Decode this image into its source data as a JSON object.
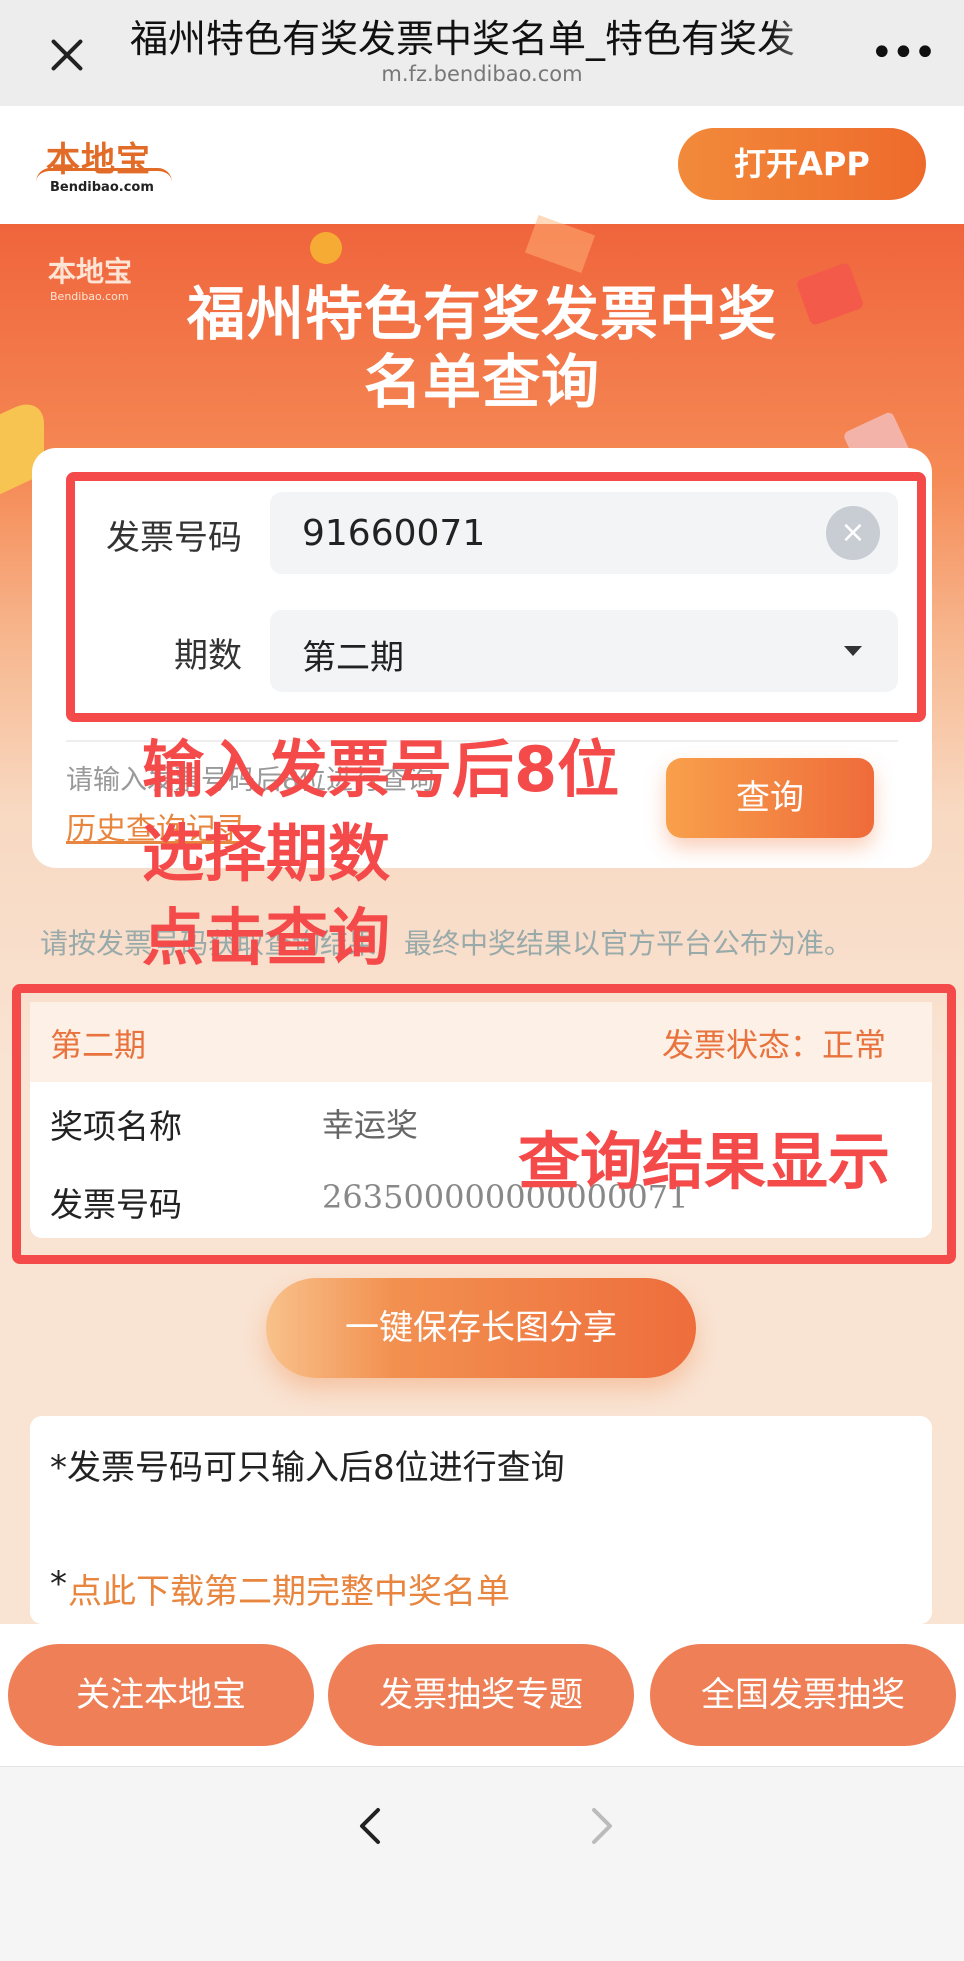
{
  "browser": {
    "title": "福州特色有奖发票中奖名单_特色有奖发",
    "url": "m.fz.bendibao.com",
    "more": "•••"
  },
  "header": {
    "logo_text": "本地宝",
    "logo_sub": "Bendibao.com",
    "open_app": "打开APP"
  },
  "hero": {
    "logo_text": "本地宝",
    "logo_sub": "Bendibao.com",
    "title_line1": "福州特色有奖发票中奖",
    "title_line2": "名单查询"
  },
  "form": {
    "invoice_label": "发票号码",
    "invoice_value": "91660071",
    "clear_icon": "×",
    "period_label": "期数",
    "period_value": "第二期",
    "hint": "请输入发票号码后8位进行查询",
    "history_link": "历史查询记录",
    "query_button": "查询"
  },
  "notice": "请按发票号码获取查询结果，最终中奖结果以官方平台公布为准。",
  "result": {
    "period": "第二期",
    "status": "发票状态：正常",
    "prize_label": "奖项名称",
    "prize_value": "幸运奖",
    "number_label": "发票号码",
    "number_value": "263500000000000071"
  },
  "save_button": "一键保存长图分享",
  "tips": {
    "tip1": "*发票号码可只输入后8位进行查询",
    "tip2_star": "*",
    "tip2": "点此下载第二期完整中奖名单"
  },
  "bottom_buttons": {
    "follow": "关注本地宝",
    "topic": "发票抽奖专题",
    "national": "全国发票抽奖"
  },
  "annotations": {
    "line1": "输入发票号后8位",
    "line2": "选择期数",
    "line3": "点击查询",
    "result_note": "查询结果显示",
    "color": "#f44a4a"
  },
  "colors": {
    "accent": "#ee6a2c",
    "link": "#e8853e",
    "bottom_button": "#ef7f56"
  }
}
